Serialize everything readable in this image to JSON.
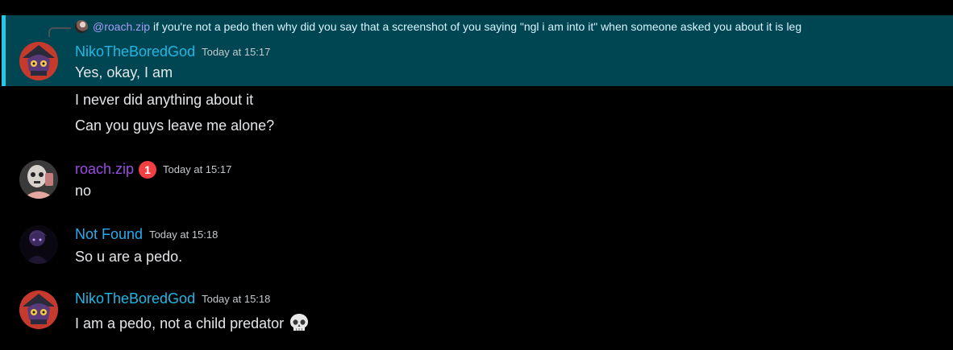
{
  "colors": {
    "background": "#000000",
    "highlight_bg": "#004552",
    "highlight_bar": "#25c8e8",
    "username_niko": "#1fb8e6",
    "username_roach": "#9b4ce0",
    "username_notfound": "#29a9ef",
    "badge": "#f23f43"
  },
  "reply": {
    "avatar_icon": "reply-avatar",
    "mention": "@roach.zip",
    "text": "if you're not a pedo then why did you say that a screenshot of you saying \"ngl i am into it\" when someone asked you about it is leg"
  },
  "messages": [
    {
      "avatar_icon": "niko-avatar",
      "username": "NikoTheBoredGod",
      "timestamp": "Today at 15:17",
      "lines": [
        "Yes, okay, I am",
        "I never did anything about it",
        "Can you guys leave me alone?"
      ]
    },
    {
      "avatar_icon": "roach-avatar",
      "username": "roach.zip",
      "badge": "1",
      "timestamp": "Today at 15:17",
      "lines": [
        "no"
      ]
    },
    {
      "avatar_icon": "notfound-avatar",
      "username": "Not Found",
      "timestamp": "Today at 15:18",
      "lines": [
        "So u are a pedo."
      ]
    },
    {
      "avatar_icon": "niko-avatar",
      "username": "NikoTheBoredGod",
      "timestamp": "Today at 15:18",
      "lines": [
        "I am a pedo, not a child predator"
      ],
      "emoji": "skull-emoji"
    }
  ]
}
